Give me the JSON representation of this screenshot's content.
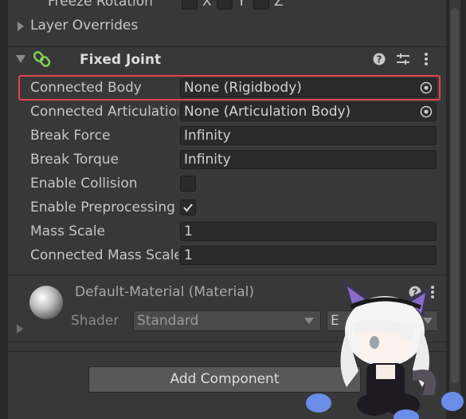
{
  "freeze_rotation": {
    "label": "Freeze Rotation",
    "axes": [
      "X",
      "Y",
      "Z"
    ]
  },
  "layer_overrides": {
    "label": "Layer Overrides"
  },
  "fixed_joint": {
    "title": "Fixed Joint",
    "properties": [
      {
        "label": "Connected Body",
        "value": "None (Rigidbody)"
      },
      {
        "label": "Connected Articulation Body",
        "value": "None (Articulation Body)"
      },
      {
        "label": "Break Force",
        "value": "Infinity"
      },
      {
        "label": "Break Torque",
        "value": "Infinity"
      },
      {
        "label": "Enable Collision",
        "checked": false
      },
      {
        "label": "Enable Preprocessing",
        "checked": true
      },
      {
        "label": "Mass Scale",
        "value": "1"
      },
      {
        "label": "Connected Mass Scale",
        "value": "1"
      }
    ]
  },
  "material": {
    "title": "Default-Material (Material)",
    "shader_label": "Shader",
    "shader_value": "Standard",
    "edit_label": "E"
  },
  "add_component": {
    "label": "Add Component"
  },
  "colors": {
    "highlight": "#e0464e",
    "joint_icon": "#7fd35a",
    "panel": "#383838"
  },
  "icons": [
    "foldout-arrow-icon",
    "fixed-joint-icon",
    "help-icon",
    "presets-icon",
    "more-options-icon",
    "object-picker-icon",
    "checkmark-icon",
    "material-sphere-icon",
    "dropdown-arrow-icon"
  ]
}
